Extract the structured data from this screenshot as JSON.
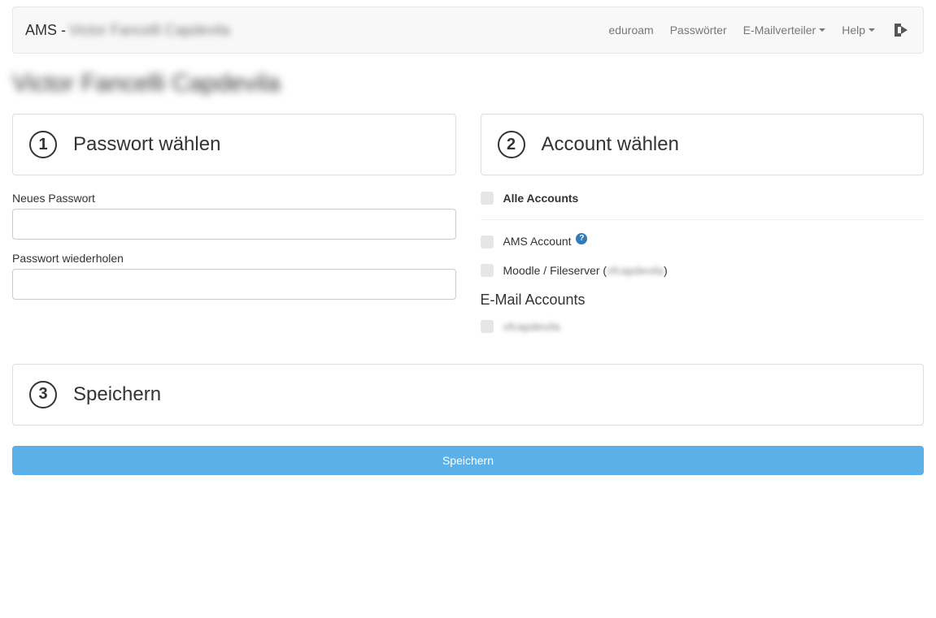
{
  "navbar": {
    "brand_prefix": "AMS -",
    "brand_user": "Victor Fancelli Capdevila",
    "links": {
      "eduroam": "eduroam",
      "passwords": "Passwörter",
      "emailverteiler": "E-Mailverteiler",
      "help": "Help"
    }
  },
  "page_title": "Victor Fancelli Capdevila",
  "panel1": {
    "number": "1",
    "title": "Passwort wählen",
    "labels": {
      "new_password": "Neues Passwort",
      "repeat_password": "Passwort wiederholen"
    }
  },
  "panel2": {
    "number": "2",
    "title": "Account wählen",
    "checkboxes": {
      "all": "Alle Accounts",
      "ams": "AMS Account",
      "moodle_prefix": "Moodle / Fileserver (",
      "moodle_user": "vfcapdevila",
      "moodle_suffix": ")"
    },
    "email_section_title": "E-Mail Accounts",
    "email_account": "vfcapdevila"
  },
  "panel3": {
    "number": "3",
    "title": "Speichern"
  },
  "save_button": "Speichern",
  "icons": {
    "help_badge": "?"
  }
}
